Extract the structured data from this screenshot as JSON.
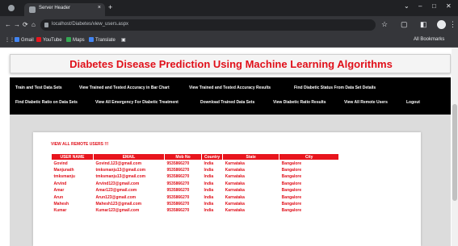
{
  "browser": {
    "tab_title": "Server Header",
    "tab_close": "×",
    "new_tab": "+",
    "url": "localhost/Diabetes/view_users.aspx",
    "window_controls": [
      "⌄",
      "–",
      "□",
      "✕"
    ],
    "nav_icons": [
      "←",
      "→",
      "⟳",
      "⌂"
    ],
    "nav_right_icons": [
      "☆",
      "⋮"
    ],
    "bookmarks": [
      {
        "label": "Gmail",
        "color": "#4285f4"
      },
      {
        "label": "YouTube",
        "color": "#e8151d"
      },
      {
        "label": "Maps",
        "color": "#34a853"
      },
      {
        "label": "Translate",
        "color": "#4285f4"
      }
    ],
    "all_bookmarks": "All Bookmarks"
  },
  "header": {
    "title": "Diabetes Disease Prediction Using Machine Learning Algorithms"
  },
  "menu": {
    "items": [
      "Train and Test Data Sets",
      "View Trained and Tested Accuracy in Bar Chart",
      "View Trained and Tested Accuracy Results",
      "Find Diabetic Status From Data Set Details",
      "Find Diabetic Ratio on Data Sets",
      "View All Emergency For Diabetic Treatment",
      "Download Trained Data Sets",
      "View Diabetic Ratio Results",
      "View All Remote Users",
      "Logout"
    ]
  },
  "main": {
    "section_title": "VIEW ALL REMOTE USERS !!!",
    "columns": [
      "USER NAME",
      "EMAIL",
      "Mob No",
      "Country",
      "State",
      "City"
    ],
    "rows": [
      [
        "Govind",
        "Govind.123@gmail.com",
        "9535866270",
        "India",
        "Karnataka",
        "Bangalore"
      ],
      [
        "Manjunath",
        "tmksmanju13@gmail.com",
        "9535866270",
        "India",
        "Karnataka",
        "Bangalore"
      ],
      [
        "tmksmanju",
        "tmksmanju13@gmail.com",
        "9535866270",
        "India",
        "Karnataka",
        "Bangalore"
      ],
      [
        "Arvind",
        "Arvind123@gmail.com",
        "9535866270",
        "India",
        "Karnataka",
        "Bangalore"
      ],
      [
        "Amar",
        "Amar123@gmail.com",
        "9535866270",
        "India",
        "Karnataka",
        "Bangalore"
      ],
      [
        "Arun",
        "Arun123@gmail.com",
        "9535866270",
        "India",
        "Karnataka",
        "Bangalore"
      ],
      [
        "Mahesh",
        "Mahesh123@gmail.com",
        "9535866270",
        "India",
        "Karnataka",
        "Bangalore"
      ],
      [
        "Kumar",
        "Kumar123@gmail.com",
        "9535866270",
        "India",
        "Karnataka",
        "Bangalore"
      ]
    ]
  },
  "colors": {
    "accent_red": "#e0101a",
    "menu_bg": "#000000",
    "browser_bg": "#202124"
  }
}
